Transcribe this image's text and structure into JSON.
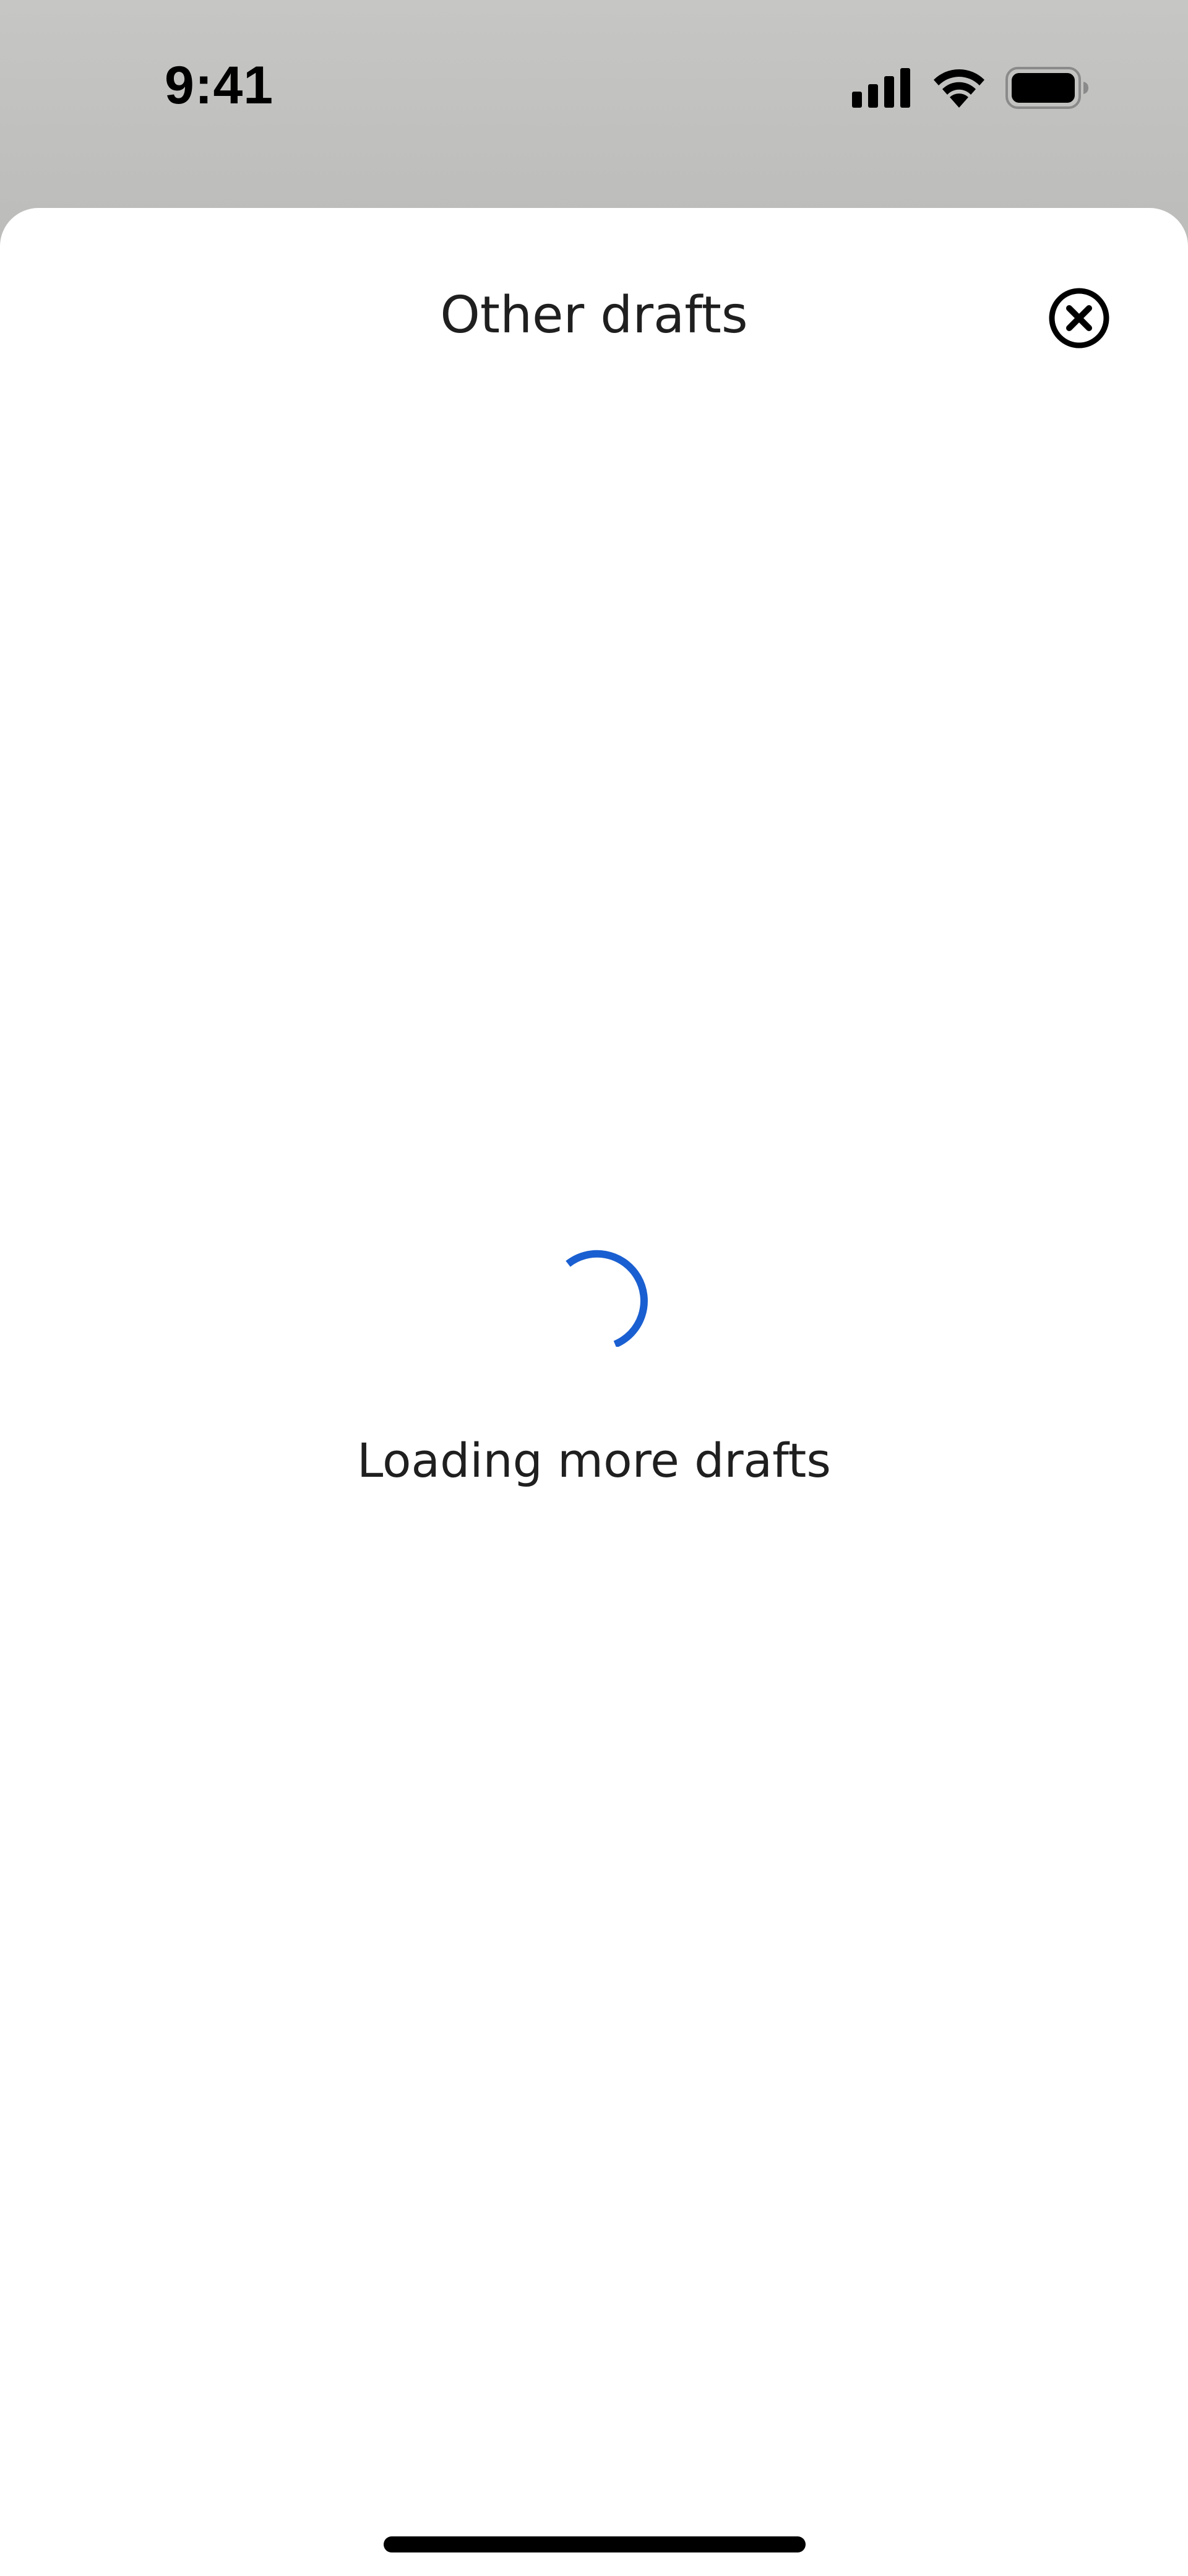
{
  "status_bar": {
    "time": "9:41",
    "icons": [
      "signal-icon",
      "wifi-icon",
      "battery-icon"
    ]
  },
  "sheet": {
    "title": "Other drafts",
    "close_icon": "close-circle-icon"
  },
  "loading": {
    "text": "Loading more drafts",
    "spinner_color": "#1a5fd1"
  },
  "colors": {
    "backdrop": "#c2c2c0",
    "sheet_background": "#ffffff",
    "text": "#1f1f1f"
  }
}
